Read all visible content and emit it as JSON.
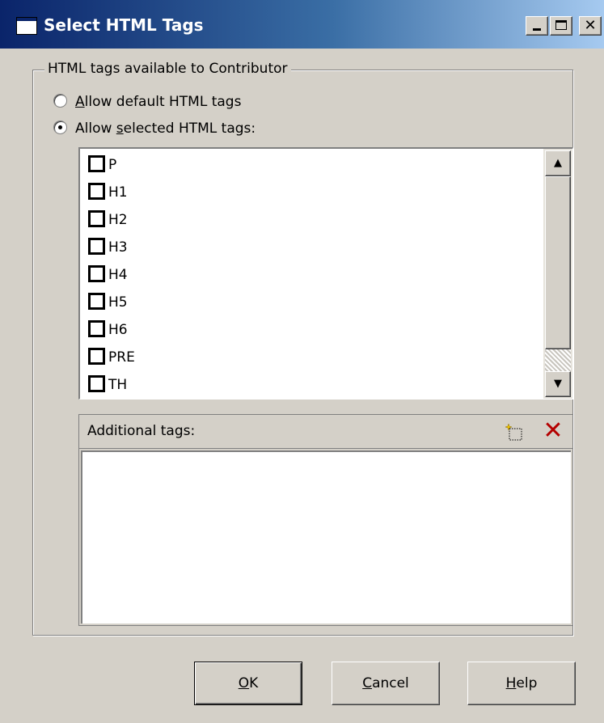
{
  "window": {
    "title": "Select HTML Tags",
    "controls": {
      "minimize": "_",
      "maximize": "□",
      "close": "✕"
    }
  },
  "group": {
    "legend": "HTML tags available to Contributor",
    "options": [
      {
        "key": "A",
        "rest": "llow default HTML tags",
        "selected": false
      },
      {
        "prefix": "Allow ",
        "key": "s",
        "rest": "elected HTML tags:",
        "selected": true
      }
    ]
  },
  "tag_list": {
    "items": [
      "P",
      "H1",
      "H2",
      "H3",
      "H4",
      "H5",
      "H6",
      "PRE",
      "TH"
    ],
    "checked": [
      false,
      false,
      false,
      false,
      false,
      false,
      false,
      false,
      false
    ]
  },
  "additional": {
    "label": "Additional tags:",
    "items": []
  },
  "buttons": {
    "ok": {
      "key": "O",
      "rest": "K"
    },
    "cancel": {
      "key": "C",
      "rest": "ancel"
    },
    "help": {
      "key": "H",
      "rest": "elp"
    }
  },
  "icons": {
    "new_tag": "new-tag-icon",
    "delete_tag": "delete-tag-icon"
  },
  "colors": {
    "title_start": "#0a246a",
    "title_end": "#a6caf0",
    "face": "#d4d0c8",
    "delete_red": "#b40000"
  }
}
